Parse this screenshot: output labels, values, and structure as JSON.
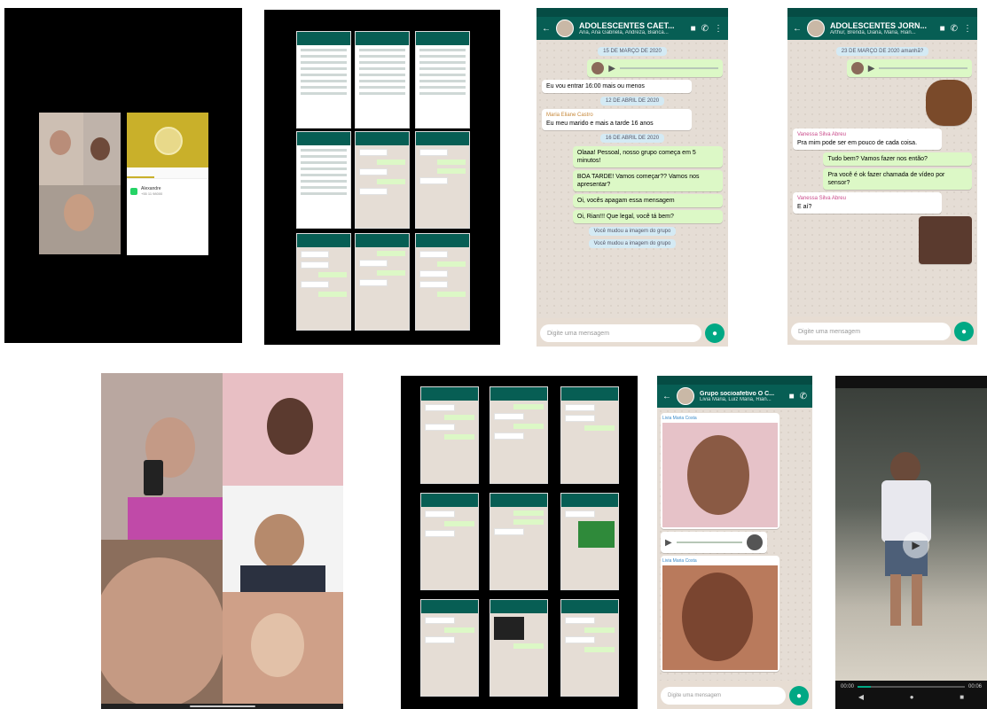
{
  "wa_chat1": {
    "title": "ADOLESCENTES CAET...",
    "subtitle": "Ana, Ana Gabriela, Andreza, Bianca...",
    "messages": [
      {
        "type": "date",
        "text": "15 DE MARÇO DE 2020"
      },
      {
        "type": "in",
        "text": "Eu vou entrar 16:00 mais ou menos"
      },
      {
        "type": "date",
        "text": "12 DE ABRIL DE 2020"
      },
      {
        "type": "in",
        "sender": "Maria Eliane Castro",
        "text": "Eu meu marido e mais a tarde 16 anos"
      },
      {
        "type": "date",
        "text": "16 DE ABRIL DE 2020"
      },
      {
        "type": "out",
        "text": "Olaaa! Pessoal, nosso grupo começa em 5 minutos!"
      },
      {
        "type": "out",
        "text": "BOA TARDE! Vamos começar?? Vamos nos apresentar?"
      },
      {
        "type": "out",
        "text": "Oi, vocês apagam essa mensagem"
      },
      {
        "type": "out",
        "text": "Oi, Rian!!! Que legal, você tá bem?"
      },
      {
        "type": "date",
        "text": "Você mudou a imagem do grupo"
      },
      {
        "type": "date",
        "text": "Você mudou a imagem do grupo"
      }
    ],
    "composer_placeholder": "Digite uma mensagem"
  },
  "wa_chat2": {
    "title": "ADOLESCENTES JORN...",
    "subtitle": "Arthur, Brenda, Diana, Maria, Rian...",
    "messages": [
      {
        "type": "date",
        "text": "23 DE MARÇO DE 2020 amanhã?"
      },
      {
        "type": "in",
        "sender": "Vanessa Silva Abreu",
        "text": "Pra mim pode ser em pouco de cada coisa."
      },
      {
        "type": "out",
        "text": "Tudo bem? Vamos fazer nos então?"
      },
      {
        "type": "out",
        "text": "Pra você é ok fazer chamada de vídeo por sensor?"
      },
      {
        "type": "in",
        "sender": "Vanessa Silva Abreu",
        "text": "E aí?"
      }
    ],
    "composer_placeholder": "Digite uma mensagem"
  },
  "wa_chat3": {
    "title": "Grupo socioafetivo O C...",
    "subtitle": "Livia Maria, Luiz Maria, Rian...",
    "sender": "Livia Maria Costa",
    "composer_placeholder": "Digite uma mensagem"
  },
  "video_player": {
    "time_start": "00:00",
    "time_end": "00:06",
    "progress": 0.12
  },
  "contact_screen": {
    "name": "Alexandre",
    "number": "+55 11 98000",
    "tab_labels": [
      "",
      "",
      ""
    ]
  },
  "colors": {
    "wa_header": "#075e54",
    "wa_accent": "#00a884",
    "outgoing_bubble": "#dcf8c6"
  }
}
